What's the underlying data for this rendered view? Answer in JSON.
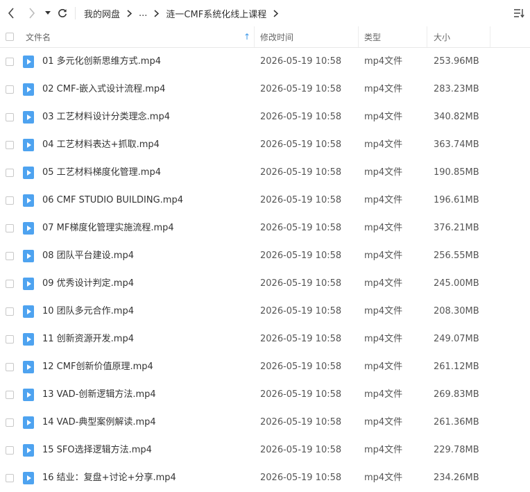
{
  "toolbar": {
    "back_icon": "chevron-left-icon",
    "forward_icon": "chevron-right-icon",
    "history_dropdown_icon": "caret-down-icon",
    "refresh_icon": "refresh-icon",
    "sort_icon": "sort-list-icon",
    "breadcrumb": [
      "我的网盘",
      "...",
      "涟一CMF系统化线上课程"
    ]
  },
  "columns": {
    "name": "文件名",
    "modified": "修改时间",
    "type": "类型",
    "size": "大小",
    "sort_indicator": "↑"
  },
  "colors": {
    "accent": "#3b97e8",
    "file_icon": "#4ea3f0"
  },
  "files": [
    {
      "name": "01 多元化创新思维方式.mp4",
      "modified": "2026-05-19 10:58",
      "type": "mp4文件",
      "size": "253.96MB"
    },
    {
      "name": "02 CMF-嵌入式设计流程.mp4",
      "modified": "2026-05-19 10:58",
      "type": "mp4文件",
      "size": "283.23MB"
    },
    {
      "name": "03 工艺材料设计分类理念.mp4",
      "modified": "2026-05-19 10:58",
      "type": "mp4文件",
      "size": "340.82MB"
    },
    {
      "name": "04 工艺材料表达+抓取.mp4",
      "modified": "2026-05-19 10:58",
      "type": "mp4文件",
      "size": "363.74MB"
    },
    {
      "name": "05 工艺材料梯度化管理.mp4",
      "modified": "2026-05-19 10:58",
      "type": "mp4文件",
      "size": "190.85MB"
    },
    {
      "name": "06 CMF STUDIO BUILDING.mp4",
      "modified": "2026-05-19 10:58",
      "type": "mp4文件",
      "size": "196.61MB"
    },
    {
      "name": "07 MF梯度化管理实施流程.mp4",
      "modified": "2026-05-19 10:58",
      "type": "mp4文件",
      "size": "376.21MB"
    },
    {
      "name": "08 团队平台建设.mp4",
      "modified": "2026-05-19 10:58",
      "type": "mp4文件",
      "size": "256.55MB"
    },
    {
      "name": "09 优秀设计判定.mp4",
      "modified": "2026-05-19 10:58",
      "type": "mp4文件",
      "size": "245.00MB"
    },
    {
      "name": "10 团队多元合作.mp4",
      "modified": "2026-05-19 10:58",
      "type": "mp4文件",
      "size": "208.30MB"
    },
    {
      "name": "11 创新资源开发.mp4",
      "modified": "2026-05-19 10:58",
      "type": "mp4文件",
      "size": "249.07MB"
    },
    {
      "name": "12 CMF创新价值原理.mp4",
      "modified": "2026-05-19 10:58",
      "type": "mp4文件",
      "size": "261.12MB"
    },
    {
      "name": "13 VAD-创新逻辑方法.mp4",
      "modified": "2026-05-19 10:58",
      "type": "mp4文件",
      "size": "269.83MB"
    },
    {
      "name": "14 VAD-典型案例解读.mp4",
      "modified": "2026-05-19 10:58",
      "type": "mp4文件",
      "size": "261.36MB"
    },
    {
      "name": "15 SFO选择逻辑方法.mp4",
      "modified": "2026-05-19 10:58",
      "type": "mp4文件",
      "size": "229.78MB"
    },
    {
      "name": "16 结业：复盘+讨论+分享.mp4",
      "modified": "2026-05-19 10:58",
      "type": "mp4文件",
      "size": "234.26MB"
    }
  ]
}
